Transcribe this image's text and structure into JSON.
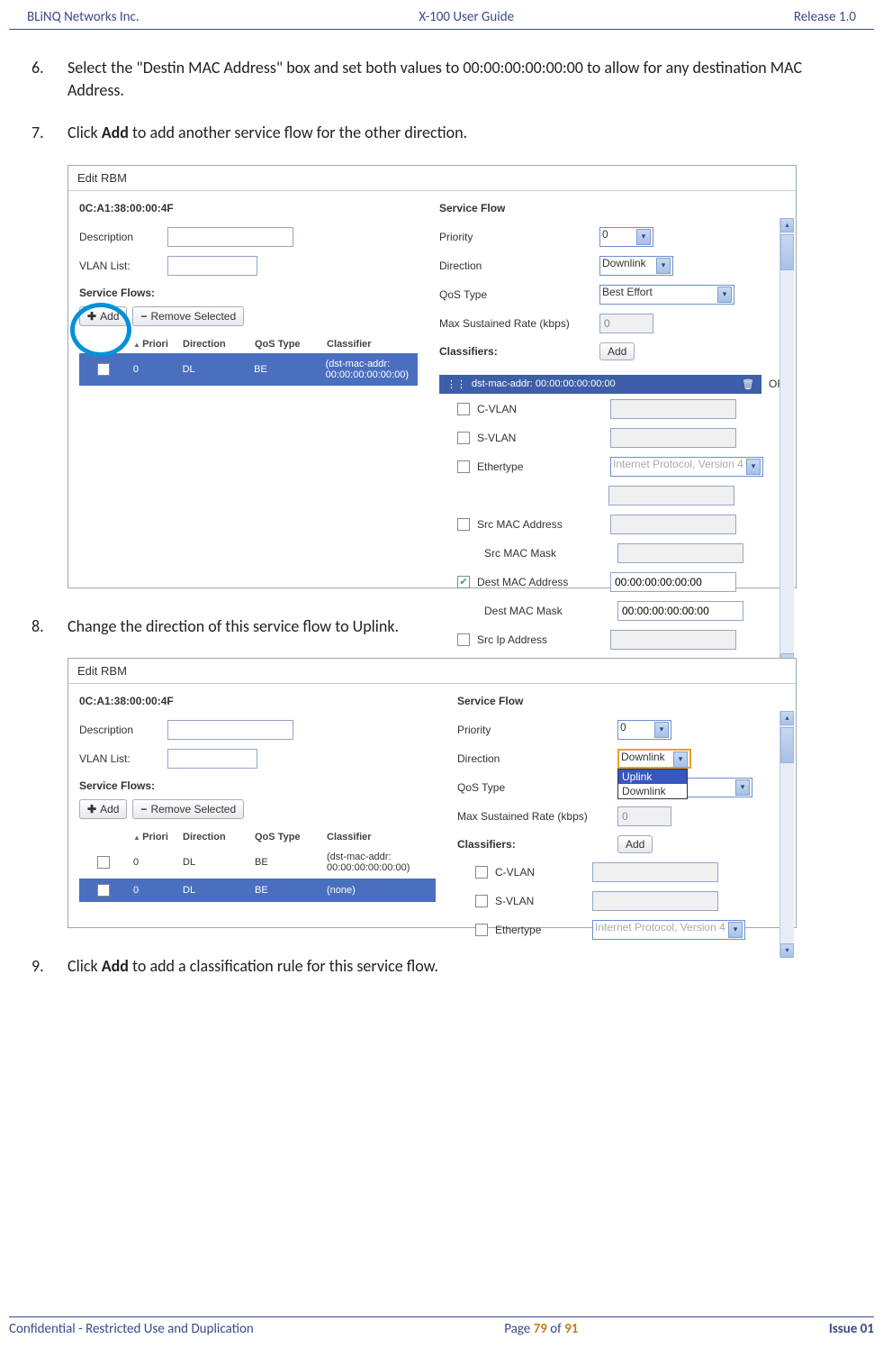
{
  "header": {
    "left": "BLiNQ Networks Inc.",
    "center": "X-100 User Guide",
    "right": "Release 1.0"
  },
  "steps": {
    "s6_num": "6.",
    "s6": "Select the \"Destin MAC Address\" box and set both values to 00:00:00:00:00:00 to allow for any destination MAC Address.",
    "s7_num": "7.",
    "s7_a": "Click ",
    "s7_b": "Add",
    "s7_c": " to add another service flow for the other direction.",
    "s8_num": "8.",
    "s8": "Change the direction of this service flow to Uplink.",
    "s9_num": "9.",
    "s9_a": "Click ",
    "s9_b": "Add",
    "s9_c": " to add a classification rule for this service flow."
  },
  "fig1": {
    "title": "Edit RBM",
    "mac": "0C:A1:38:00:00:4F",
    "desc_label": "Description",
    "vlan_label": "VLAN List:",
    "svc_label": "Service Flows:",
    "add_btn": "Add",
    "remove_btn": "Remove Selected",
    "cols": {
      "c1": "Priori",
      "c2": "Direction",
      "c3": "QoS Type",
      "c4": "Classifier"
    },
    "row": {
      "priority": "0",
      "dir": "DL",
      "qos": "BE",
      "cls": "(dst-mac-addr: 00:00:00:00:00:00)"
    },
    "sf_head": "Service Flow",
    "priority_l": "Priority",
    "priority_v": "0",
    "dir_l": "Direction",
    "dir_v": "Downlink",
    "qos_l": "QoS Type",
    "qos_v": "Best Effort",
    "rate_l": "Max Sustained Rate (kbps)",
    "rate_v": "0",
    "class_l": "Classifiers:",
    "class_btn": "Add",
    "class_line": "dst-mac-addr: 00:00:00:00:00:00",
    "or": "OR",
    "cvlan": "C-VLAN",
    "svlan": "S-VLAN",
    "eth": "Ethertype",
    "eth_v": "Internet Protocol, Version 4",
    "srcmac": "Src MAC Address",
    "srcmask": "Src MAC Mask",
    "dstmac": "Dest MAC Address",
    "dstmask": "Dest MAC Mask",
    "dstmac_v": "00:00:00:00:00:00",
    "dstmask_v": "00:00:00:00:00:00",
    "srcip": "Src Ip Address"
  },
  "fig2": {
    "title": "Edit RBM",
    "mac": "0C:A1:38:00:00:4F",
    "desc_label": "Description",
    "vlan_label": "VLAN List:",
    "svc_label": "Service Flows:",
    "add_btn": "Add",
    "remove_btn": "Remove Selected",
    "cols": {
      "c1": "Priori",
      "c2": "Direction",
      "c3": "QoS Type",
      "c4": "Classifier"
    },
    "row1": {
      "priority": "0",
      "dir": "DL",
      "qos": "BE",
      "cls": "(dst-mac-addr: 00:00:00:00:00:00)"
    },
    "row2": {
      "priority": "0",
      "dir": "DL",
      "qos": "BE",
      "cls": "(none)"
    },
    "sf_head": "Service Flow",
    "priority_l": "Priority",
    "priority_v": "0",
    "dir_l": "Direction",
    "dir_v": "Downlink",
    "dd_opt1": "Uplink",
    "dd_opt2": "Downlink",
    "qos_l": "QoS Type",
    "rate_l": "Max Sustained Rate (kbps)",
    "rate_v": "0",
    "class_l": "Classifiers:",
    "class_btn": "Add",
    "cvlan": "C-VLAN",
    "svlan": "S-VLAN",
    "eth": "Ethertype",
    "eth_v": "Internet Protocol, Version 4"
  },
  "footer": {
    "left": "Confidential - Restricted Use and Duplication",
    "center_a": "Page ",
    "center_b": "79",
    "center_c": " of ",
    "center_d": "91",
    "right": "Issue 01"
  }
}
